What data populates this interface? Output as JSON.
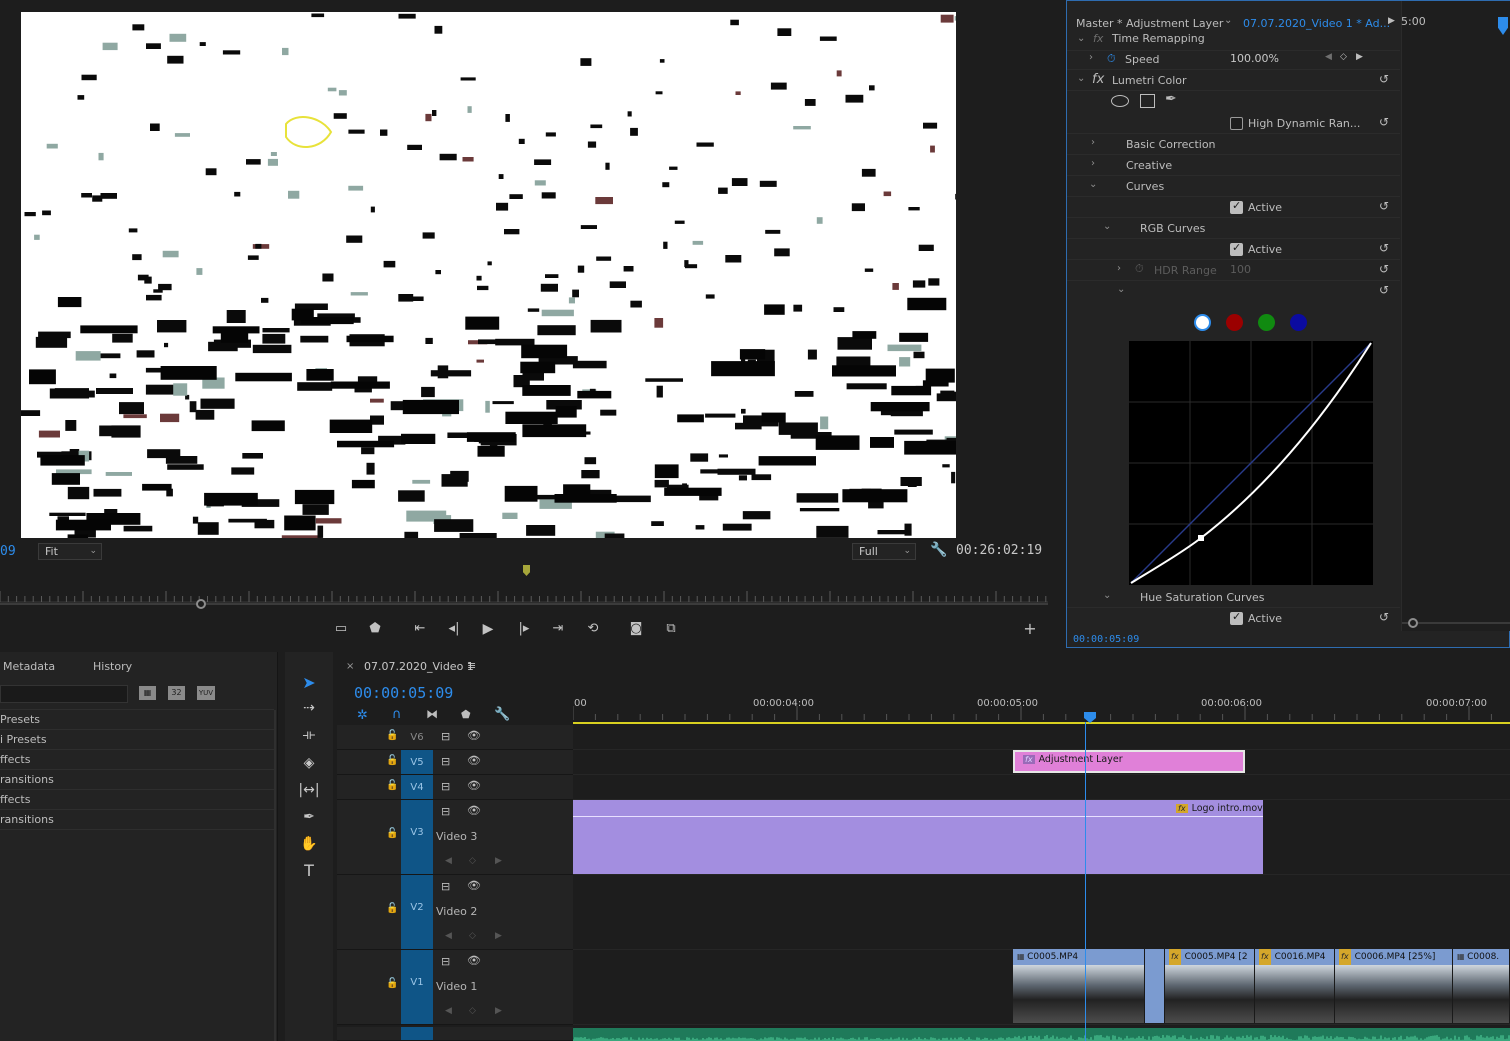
{
  "program_monitor": {
    "left_timecode_fragment": "09",
    "zoom": "Fit",
    "resolution": "Full",
    "duration": "00:26:02:19"
  },
  "effect_controls": {
    "source_label": "Master * Adjustment Layer",
    "sequence_label": "07.07.2020_Video 1 * Ad...",
    "time_display": "5:00",
    "time_remapping": "Time Remapping",
    "speed_label": "Speed",
    "speed_value": "100.00%",
    "lumetri": "Lumetri Color",
    "hdr_label": "High Dynamic Ran...",
    "basic_correction": "Basic Correction",
    "creative": "Creative",
    "curves": "Curves",
    "active_label": "Active",
    "rgb_curves": "RGB Curves",
    "hdr_range_label": "HDR Range",
    "hdr_range_value": "100",
    "hue_sat": "Hue Saturation Curves",
    "current_time": "00:00:05:09",
    "curve_colors": [
      "#ffffff",
      "#cc0000",
      "#1aa01a",
      "#2020d0"
    ]
  },
  "panels": {
    "metadata_tab": "Metadata",
    "history_tab": "History",
    "filter_32": "32",
    "filter_yuv": "YUV",
    "effects_items": [
      "Presets",
      "i Presets",
      "ffects",
      "ransitions",
      "ffects",
      "ransitions"
    ]
  },
  "timeline": {
    "sequence_name": "07.07.2020_Video 1",
    "current_time": "00:00:05:09",
    "ruler_labels": [
      "00",
      "00:00:04:00",
      "00:00:05:00",
      "00:00:06:00",
      "00:00:07:00"
    ],
    "tracks": [
      {
        "id": "V6",
        "name": ""
      },
      {
        "id": "V5",
        "name": ""
      },
      {
        "id": "V4",
        "name": ""
      },
      {
        "id": "V3",
        "name": "Video 3"
      },
      {
        "id": "V2",
        "name": "Video 2"
      },
      {
        "id": "V1",
        "name": "Video 1"
      }
    ],
    "adjustment_clip": "Adjustment Layer",
    "logo_clip": "Logo intro.mov",
    "fx_badge": "fx",
    "v1_clips": [
      "C0005.MP4",
      "C0005.MP4 [2",
      "C0016.MP4",
      "C0006.MP4 [25%]",
      "C0008."
    ]
  }
}
